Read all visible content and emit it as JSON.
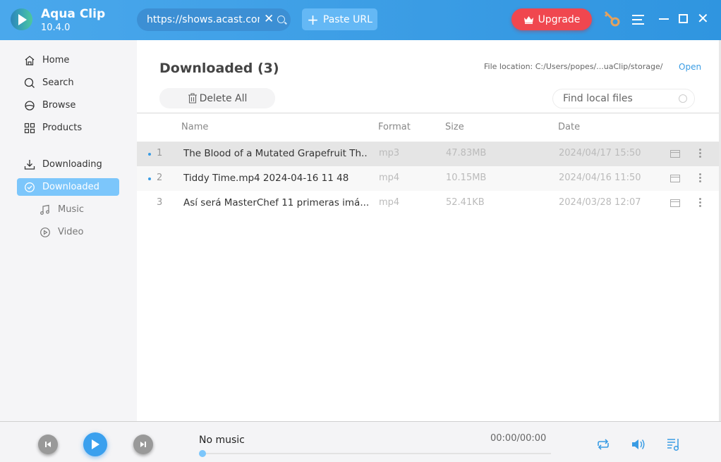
{
  "app": {
    "name": "Aqua Clip",
    "version": "10.4.0"
  },
  "titlebar": {
    "url_value": "https://shows.acast.com/",
    "paste_label": "Paste URL",
    "upgrade_label": "Upgrade",
    "icons": [
      "logo-icon",
      "clear-icon",
      "search-icon",
      "plus-icon",
      "crown-icon",
      "key-icon",
      "menu-icon",
      "minimize-icon",
      "maximize-icon",
      "close-icon"
    ]
  },
  "sidebar": {
    "items": [
      {
        "label": "Home",
        "icon": "home-icon"
      },
      {
        "label": "Search",
        "icon": "search-icon"
      },
      {
        "label": "Browse",
        "icon": "browse-icon"
      },
      {
        "label": "Products",
        "icon": "grid-icon"
      },
      {
        "label": "Downloading",
        "icon": "download-icon"
      },
      {
        "label": "Downloaded",
        "icon": "check-circle-icon",
        "active": true
      },
      {
        "label": "Music",
        "icon": "music-icon"
      },
      {
        "label": "Video",
        "icon": "play-circle-icon"
      }
    ]
  },
  "main": {
    "title": "Downloaded (3)",
    "file_location": "File location: C:/Users/popes/...uaClip/storage/",
    "open_label": "Open",
    "delete_all_label": "Delete All",
    "find_placeholder": "Find local files",
    "columns": [
      "Name",
      "Format",
      "Size",
      "Date"
    ],
    "rows": [
      {
        "index": "1",
        "name": "The Blood of a Mutated Grapefruit   Th..",
        "format": "mp3",
        "size": "47.83MB",
        "date": "2024/04/17 15:50",
        "new": true,
        "selected": true
      },
      {
        "index": "2",
        "name": "Tiddy Time.mp4 2024-04-16 11 48",
        "format": "mp4",
        "size": "10.15MB",
        "date": "2024/04/16 11:50",
        "new": true
      },
      {
        "index": "3",
        "name": "Así será MasterChef 11  primeras imá...",
        "format": "mp4",
        "size": "52.41KB",
        "date": "2024/03/28 12:07",
        "new": false
      }
    ]
  },
  "player": {
    "track": "No music",
    "time": "00:00/00:00",
    "progress": 0
  },
  "colors": {
    "accent": "#3a9ce4",
    "active_nav": "#7cc6fb",
    "upgrade": "#f0474f"
  }
}
